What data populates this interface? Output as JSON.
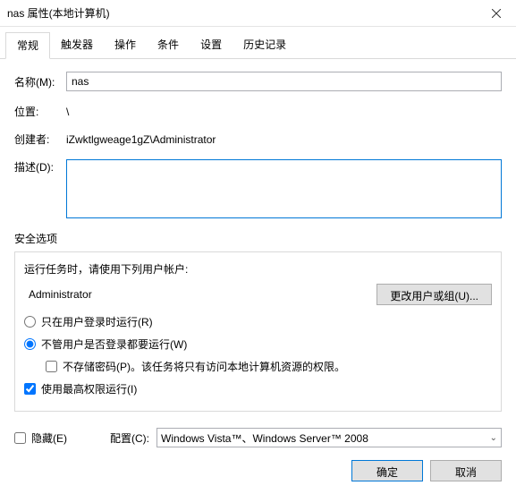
{
  "window": {
    "title": "nas 属性(本地计算机)"
  },
  "tabs": [
    {
      "label": "常规",
      "active": true
    },
    {
      "label": "触发器"
    },
    {
      "label": "操作"
    },
    {
      "label": "条件"
    },
    {
      "label": "设置"
    },
    {
      "label": "历史记录"
    }
  ],
  "fields": {
    "name_label": "名称(M):",
    "name_value": "nas",
    "location_label": "位置:",
    "location_value": "\\",
    "creator_label": "创建者:",
    "creator_value": "iZwktlgweage1gZ\\Administrator",
    "desc_label": "描述(D):",
    "desc_value": ""
  },
  "security": {
    "section_title": "安全选项",
    "run_as_label": "运行任务时，请使用下列用户帐户:",
    "account": "Administrator",
    "change_user_btn": "更改用户或组(U)...",
    "radio_logged_on": "只在用户登录时运行(R)",
    "radio_always": "不管用户是否登录都要运行(W)",
    "no_store_pw": "不存储密码(P)。该任务将只有访问本地计算机资源的权限。",
    "highest_priv": "使用最高权限运行(I)",
    "radio_selected": "always",
    "highest_checked": true,
    "no_store_checked": false
  },
  "bottom": {
    "hidden_label": "隐藏(E)",
    "hidden_checked": false,
    "configure_label": "配置(C):",
    "configure_value": "Windows Vista™、Windows Server™ 2008"
  },
  "buttons": {
    "ok": "确定",
    "cancel": "取消"
  }
}
